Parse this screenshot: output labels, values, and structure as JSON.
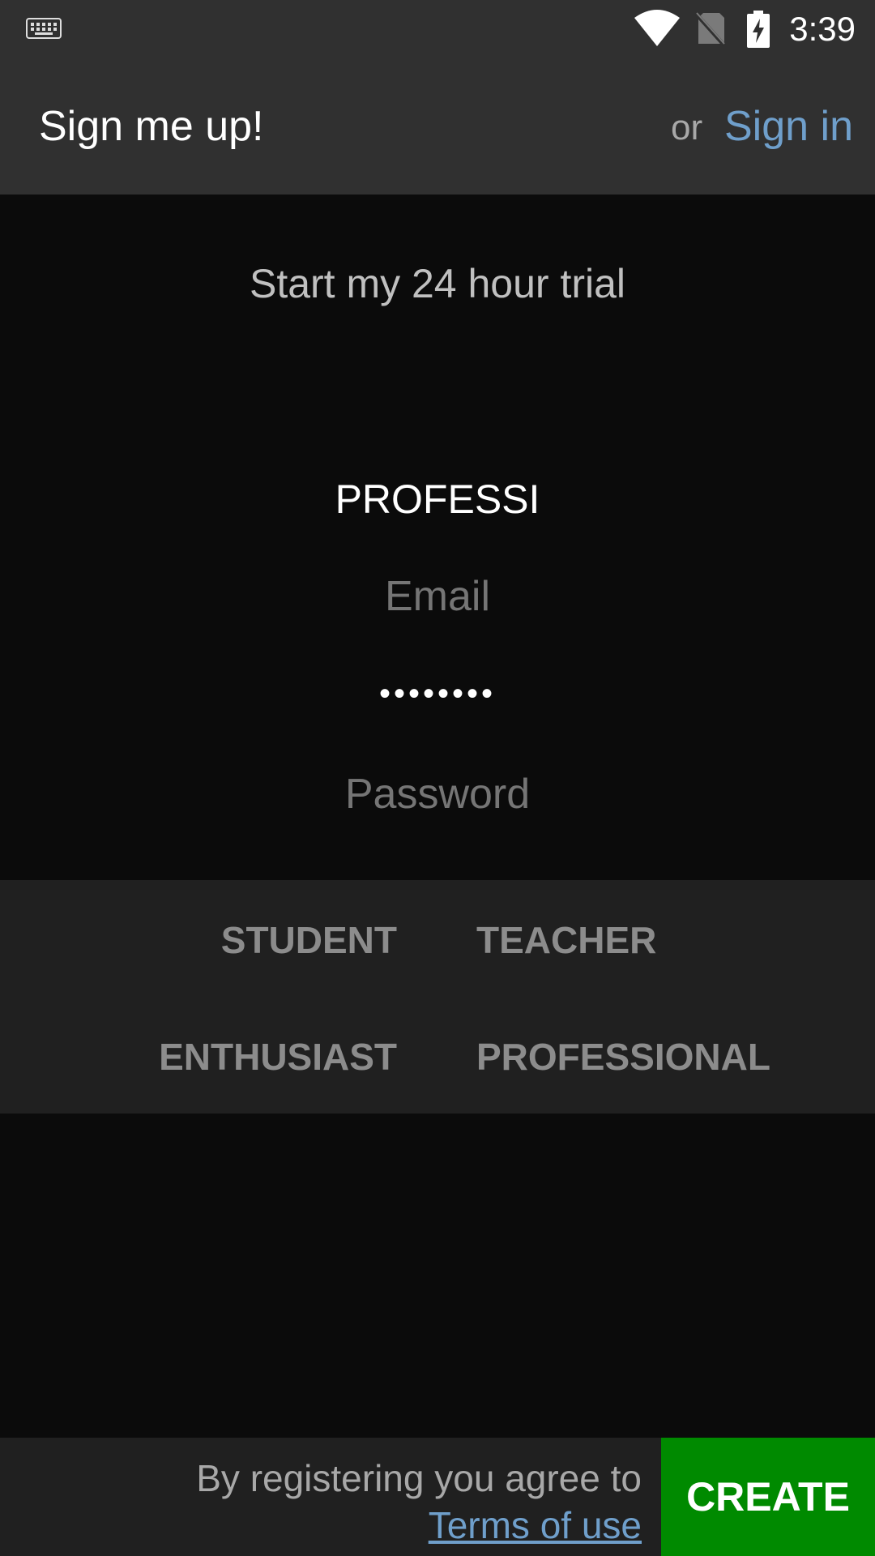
{
  "status_bar": {
    "time": "3:39",
    "icons": [
      "keyboard-icon",
      "wifi-icon",
      "no-sim-icon",
      "battery-charging-icon"
    ]
  },
  "header": {
    "title": "Sign me up!",
    "or_text": "or",
    "sign_in_label": "Sign in"
  },
  "form": {
    "heading": "Start my 24 hour trial",
    "role_value": "PROFESSI",
    "email_placeholder": "Email",
    "password_value": "••••••••",
    "password_placeholder": "Password"
  },
  "roles": {
    "options": [
      "STUDENT",
      "TEACHER",
      "ENTHUSIAST",
      "PROFESSIONAL"
    ]
  },
  "footer": {
    "agree_text": "By registering you agree to",
    "terms_label": "Terms of use",
    "create_label": "CREATE"
  },
  "colors": {
    "accent_link": "#6f9fcb",
    "create_button": "#008a00",
    "background": "#0b0b0b",
    "bar_background": "#303030",
    "panel_background": "#202020"
  }
}
